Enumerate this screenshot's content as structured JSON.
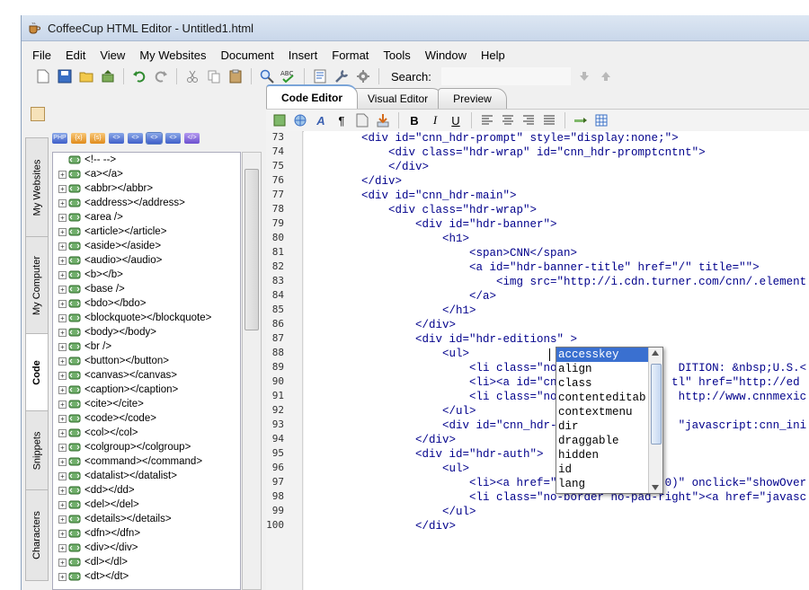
{
  "window": {
    "title": "CoffeeCup HTML Editor - Untitled1.html"
  },
  "menu": [
    "File",
    "Edit",
    "View",
    "My Websites",
    "Document",
    "Insert",
    "Format",
    "Tools",
    "Window",
    "Help"
  ],
  "search": {
    "label": "Search:",
    "value": ""
  },
  "side_tabs": [
    "My Websites",
    "My Computer",
    "Code",
    "Snippets",
    "Characters"
  ],
  "tag_buttons": [
    "PHP",
    "{x}",
    "{s}",
    "<>",
    "<>",
    "<>",
    "<>",
    "</>"
  ],
  "tree_items": [
    "<!-- -->",
    "<a></a>",
    "<abbr></abbr>",
    "<address></address>",
    "<area />",
    "<article></article>",
    "<aside></aside>",
    "<audio></audio>",
    "<b></b>",
    "<base />",
    "<bdo></bdo>",
    "<blockquote></blockquote>",
    "<body></body>",
    "<br />",
    "<button></button>",
    "<canvas></canvas>",
    "<caption></caption>",
    "<cite></cite>",
    "<code></code>",
    "<col></col>",
    "<colgroup></colgroup>",
    "<command></command>",
    "<datalist></datalist>",
    "<dd></dd>",
    "<del></del>",
    "<details></details>",
    "<dfn></dfn>",
    "<div></div>",
    "<dl></dl>",
    "<dt></dt>"
  ],
  "editor_tabs": [
    "Code Editor",
    "Visual Editor",
    "Preview"
  ],
  "format_buttons": {
    "bold": "B",
    "italic": "I",
    "underline": "U",
    "font": "A",
    "paragraph": "¶"
  },
  "code": {
    "line_numbers": [
      "73",
      "74",
      "75",
      "76",
      "77",
      "78",
      "79",
      "80",
      "81",
      "82",
      "83",
      "84",
      "85",
      "86",
      "87",
      "88",
      "89",
      "90",
      "91",
      "92",
      "93",
      "94",
      "95",
      "96",
      "97",
      "98",
      "99",
      "100"
    ],
    "lines": [
      "        <div id=\"cnn_hdr-prompt\" style=\"display:none;\">",
      "            <div class=\"hdr-wrap\" id=\"cnn_hdr-promptcntnt\">",
      "            </div>",
      "        </div>",
      "        <div id=\"cnn_hdr-main\">",
      "            <div class=\"hdr-wrap\">",
      "                <div id=\"hdr-banner\">",
      "                    <h1>",
      "                        <span>CNN</span>",
      "                        <a id=\"hdr-banner-title\" href=\"/\" title=\"\">",
      "                            <img src=\"http://i.cdn.turner.com/cnn/.element",
      "                        </a>",
      "                    </h1>",
      "                </div>",
      "                <div id=\"hdr-editions\" >",
      "                    <ul>",
      "                        <li class=\"no-pa               DITION: &nbsp;U.S.<",
      "                        <li><a id=\"cnn_s              tl\" href=\"http://ed",
      "                        <li class=\"no-bo               http://www.cnnmexic",
      "                    </ul>",
      "                    <div id=\"cnn_hdr-edi               \"javascript:cnn_ini",
      "                </div>",
      "                <div id=\"hdr-auth\">",
      "                    <ul>",
      "                        <li><a href=\"javascript:void(0)\" onclick=\"showOver",
      "                        <li class=\"no-border no-pad-right\"><a href=\"javasc",
      "                    </ul>",
      "                </div>"
    ]
  },
  "autocomplete": {
    "items": [
      "accesskey",
      "align",
      "class",
      "contenteditab",
      "contextmenu",
      "dir",
      "draggable",
      "hidden",
      "id",
      "lang"
    ],
    "selected_index": 0
  }
}
